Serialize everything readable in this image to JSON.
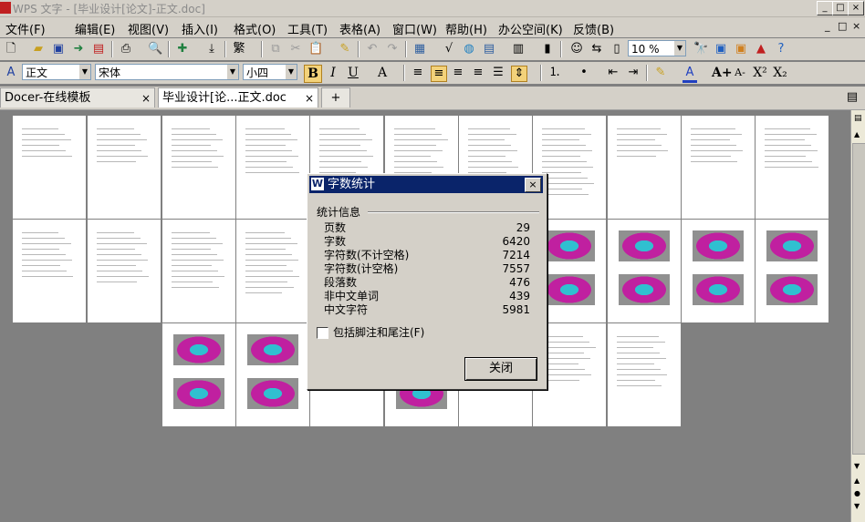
{
  "window": {
    "title": "WPS 文字 - [毕业设计[论文]-正文.doc]",
    "controls": {
      "minimize": "_",
      "maximize": "□",
      "close": "×"
    }
  },
  "menu": {
    "items": [
      "文件(F)",
      "编辑(E)",
      "视图(V)",
      "插入(I)",
      "格式(O)",
      "工具(T)",
      "表格(A)",
      "窗口(W)",
      "帮助(H)",
      "办公空间(K)",
      "反馈(B)"
    ],
    "doc_controls": {
      "minimize": "_",
      "restore": "□",
      "close": "×"
    }
  },
  "toolbar": {
    "zoom": "10 %",
    "style": "正文",
    "font": "宋体",
    "size": "小四",
    "bold": "B",
    "italic": "I",
    "underline": "U",
    "char_format": "A",
    "grow_font": "A+",
    "shrink_font": "A-",
    "superscript": "X²",
    "subscript": "X₂"
  },
  "tabs": [
    {
      "label": "Docer-在线模板",
      "close": "×",
      "active": false
    },
    {
      "label": "毕业设计[论...正文.doc",
      "close": "×",
      "active": true
    }
  ],
  "new_tab": "+",
  "dialog": {
    "title": "字数统计",
    "close": "×",
    "group_label": "统计信息",
    "stats": [
      {
        "label": "页数",
        "value": "29"
      },
      {
        "label": "字数",
        "value": "6420"
      },
      {
        "label": "字符数(不计空格)",
        "value": "7214"
      },
      {
        "label": "字符数(计空格)",
        "value": "7557"
      },
      {
        "label": "段落数",
        "value": "476"
      },
      {
        "label": "非中文单词",
        "value": "439"
      },
      {
        "label": "中文字符",
        "value": "5981"
      }
    ],
    "checkbox_label": "包括脚注和尾注(F)",
    "checkbox_checked": false,
    "close_button": "关闭"
  }
}
